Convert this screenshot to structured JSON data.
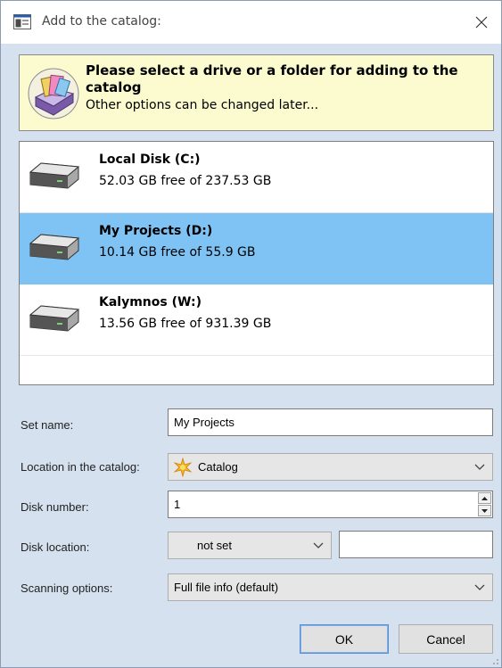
{
  "window": {
    "title": "Add to the catalog:",
    "close_glyph": "✕"
  },
  "banner": {
    "title": "Please select a drive or a folder for adding to the catalog",
    "subtitle": "Other options can be changed later..."
  },
  "drives": [
    {
      "name": "Local Disk (C:)",
      "free": "52.03 GB free of 237.53 GB",
      "selected": false
    },
    {
      "name": "My Projects (D:)",
      "free": "10.14 GB free of 55.9 GB",
      "selected": true
    },
    {
      "name": "Kalymnos (W:)",
      "free": "13.56 GB free of 931.39 GB",
      "selected": false
    }
  ],
  "form": {
    "set_name_label": "Set name:",
    "set_name_value": "My Projects",
    "location_label": "Location in the catalog:",
    "location_value": "Catalog",
    "disk_number_label": "Disk number:",
    "disk_number_value": "1",
    "disk_location_label": "Disk location:",
    "disk_location_value": "not set",
    "disk_location_extra": "",
    "scanning_label": "Scanning options:",
    "scanning_value": "Full file info (default)"
  },
  "buttons": {
    "ok": "OK",
    "cancel": "Cancel"
  },
  "colors": {
    "selection": "#7fc3f4",
    "banner_bg": "#fbfbcf",
    "dialog_bg": "#d5e1ef"
  }
}
